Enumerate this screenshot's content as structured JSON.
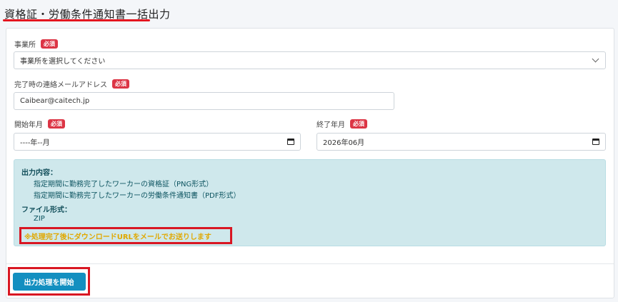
{
  "page": {
    "title": "資格証・労働条件通知書一括出力"
  },
  "required_badge": "必須",
  "office": {
    "label": "事業所",
    "selected": "事業所を選択してください"
  },
  "email": {
    "label": "完了時の連絡メールアドレス",
    "value": "Caibear@caitech.jp"
  },
  "start_month": {
    "label": "開始年月",
    "value": "----年--月"
  },
  "end_month": {
    "label": "終了年月",
    "value": "2026年06月"
  },
  "info": {
    "output_heading": "出力内容：",
    "output_items": [
      "指定期間に勤務完了したワーカーの資格証（PNG形式）",
      "指定期間に勤務完了したワーカーの労働条件通知書（PDF形式）"
    ],
    "format_heading": "ファイル形式：",
    "format_value": "ZIP",
    "notice": "※処理完了後にダウンロードURLをメールでお送りします"
  },
  "actions": {
    "start_label": "出力処理を開始"
  },
  "colors": {
    "required": "#dc3545",
    "primary_button": "#138fc0",
    "info_bg": "#cfe8ec",
    "notice_text": "#e0a800",
    "highlight": "#d91723"
  }
}
